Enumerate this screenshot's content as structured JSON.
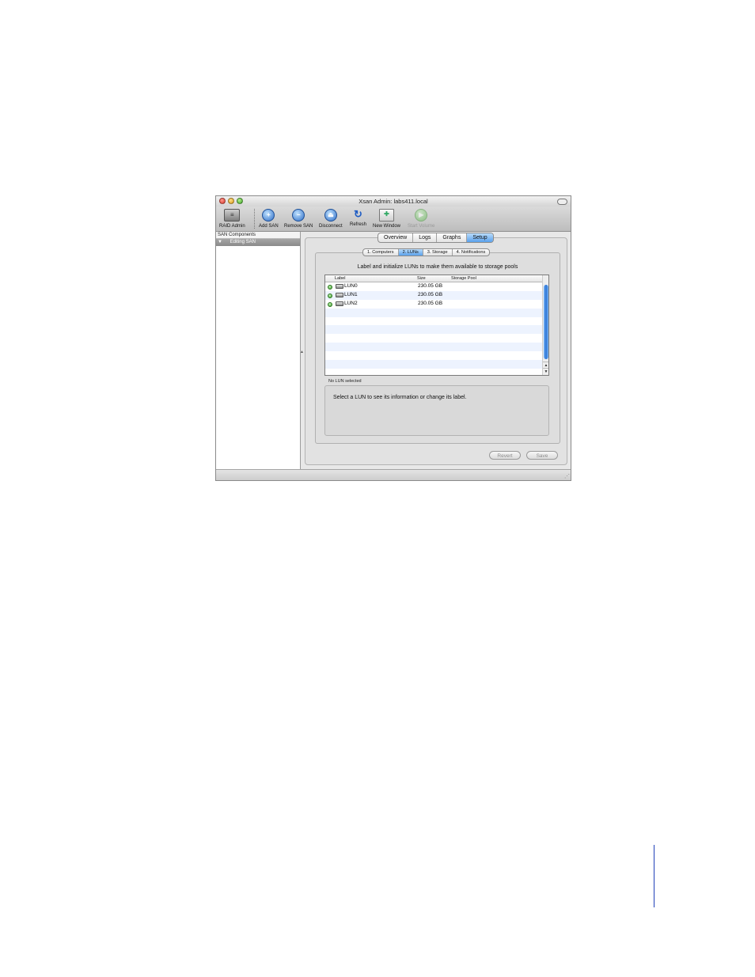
{
  "window": {
    "title": "Xsan Admin: labs411.local"
  },
  "toolbar": {
    "items": [
      {
        "label": "RAID Admin",
        "icon": "raid-admin-icon"
      },
      {
        "label": "Add SAN",
        "icon": "add-san-icon"
      },
      {
        "label": "Remove SAN",
        "icon": "remove-san-icon"
      },
      {
        "label": "Disconnect",
        "icon": "disconnect-icon"
      },
      {
        "label": "Refresh",
        "icon": "refresh-icon"
      },
      {
        "label": "New Window",
        "icon": "new-window-icon"
      },
      {
        "label": "Start Volume",
        "icon": "start-volume-icon",
        "disabled": true
      }
    ]
  },
  "sidebar": {
    "header": "SAN Components",
    "items": [
      {
        "label": "Editing SAN",
        "selected": true
      }
    ]
  },
  "tabs": {
    "items": [
      "Overview",
      "Logs",
      "Graphs",
      "Setup"
    ],
    "selected": "Setup"
  },
  "subtabs": {
    "items": [
      "1. Computers",
      "2. LUNs",
      "3. Storage",
      "4. Notifications"
    ],
    "selected": "2. LUNs"
  },
  "luns": {
    "instruction": "Label and initialize LUNs to make them available to storage pools",
    "columns": {
      "label": "Label",
      "size": "Size",
      "pool": "Storage Pool"
    },
    "rows": [
      {
        "label": "LUN0",
        "size": "230.05 GB",
        "pool": ""
      },
      {
        "label": "LUN1",
        "size": "230.05 GB",
        "pool": ""
      },
      {
        "label": "LUN2",
        "size": "230.05 GB",
        "pool": ""
      }
    ],
    "selection_status": "No LUN selected",
    "info_text": "Select a LUN to see its information or change its label."
  },
  "buttons": {
    "revert": "Revert",
    "save": "Save"
  },
  "colors": {
    "accent": "#5aa1ec",
    "status_online": "#3a9b2c",
    "page_rule": "#2040b8"
  }
}
